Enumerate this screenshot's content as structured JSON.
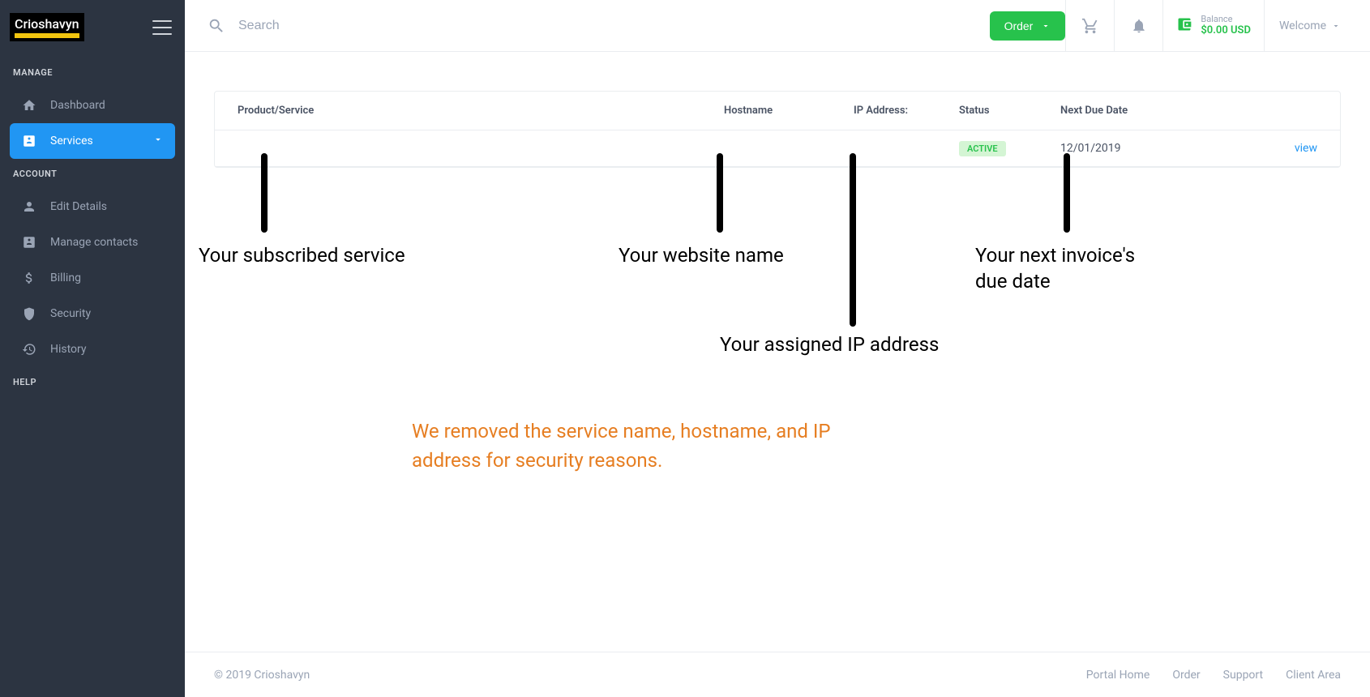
{
  "brand": "Crioshavyn",
  "search": {
    "placeholder": "Search"
  },
  "header": {
    "order_label": "Order",
    "balance_label": "Balance",
    "balance_amount": "$0.00 USD",
    "welcome_label": "Welcome"
  },
  "sidebar": {
    "sections": {
      "manage": "MANAGE",
      "account": "ACCOUNT",
      "help": "HELP"
    },
    "items": {
      "dashboard": "Dashboard",
      "services": "Services",
      "edit_details": "Edit Details",
      "manage_contacts": "Manage contacts",
      "billing": "Billing",
      "security": "Security",
      "history": "History"
    }
  },
  "table": {
    "headers": {
      "product": "Product/Service",
      "hostname": "Hostname",
      "ip": "IP Address:",
      "status": "Status",
      "due": "Next Due Date"
    },
    "rows": [
      {
        "product": "",
        "hostname": "",
        "ip": "",
        "status": "ACTIVE",
        "due": "12/01/2019",
        "action": "view"
      }
    ]
  },
  "annotations": {
    "product": "Your subscribed service",
    "hostname": "Your website name",
    "ip": "Your assigned IP address",
    "due": "Your next invoice's due date",
    "notice": "We removed the service name, hostname, and IP address for security reasons."
  },
  "footer": {
    "copyright": "© 2019 Crioshavyn",
    "links": {
      "portal": "Portal Home",
      "order": "Order",
      "support": "Support",
      "client": "Client Area"
    }
  }
}
